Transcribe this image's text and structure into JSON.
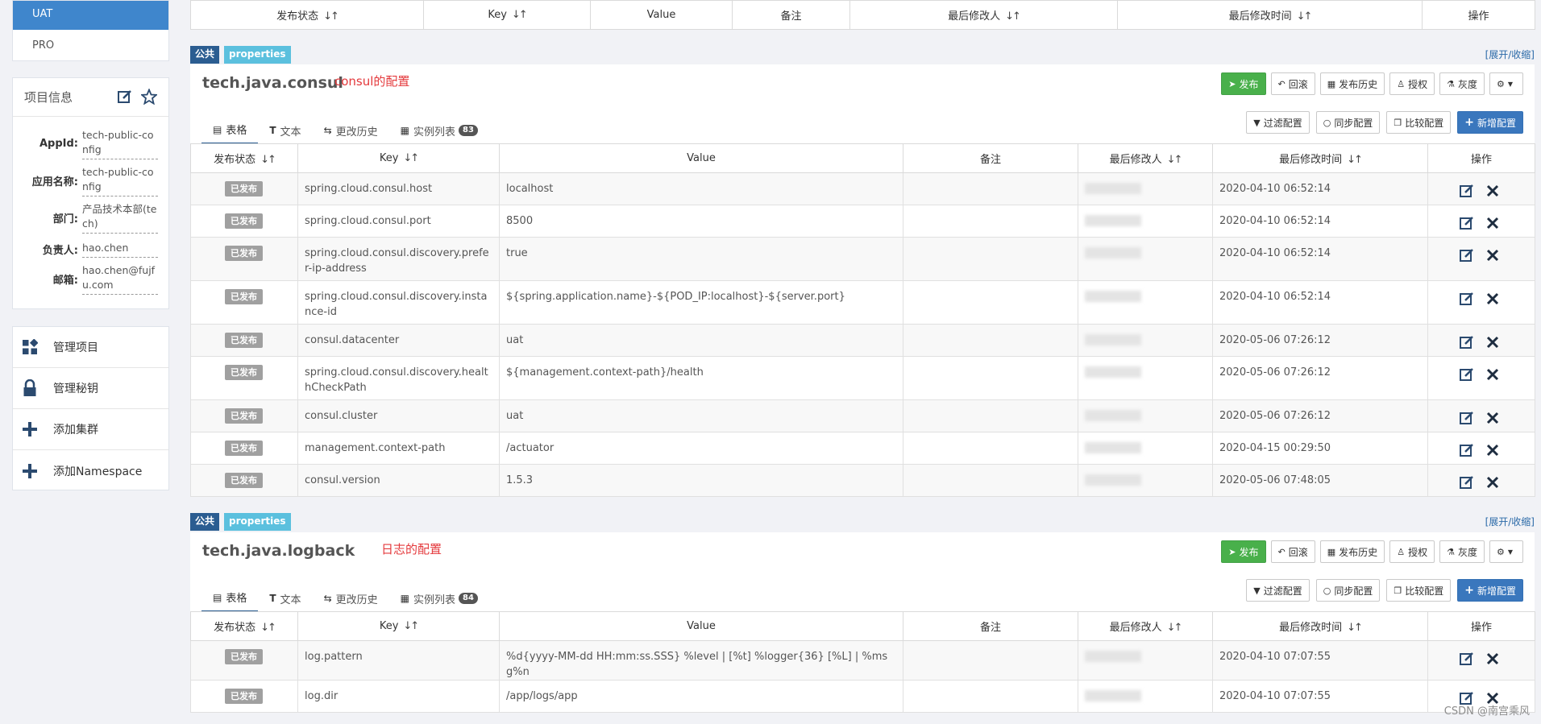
{
  "sidebar": {
    "envs": [
      "UAT",
      "PRO"
    ],
    "info_title": "项目信息",
    "info": [
      {
        "key": "AppId:",
        "value": "tech-public-config"
      },
      {
        "key": "应用名称:",
        "value": "tech-public-config"
      },
      {
        "key": "部门:",
        "value": "产品技术本部(tech)"
      },
      {
        "key": "负责人:",
        "value": "hao.chen"
      },
      {
        "key": "邮箱:",
        "value": "hao.chen@fujfu.com"
      }
    ],
    "menu": [
      {
        "label": "管理项目",
        "icon": "grid-icon"
      },
      {
        "label": "管理秘钥",
        "icon": "lock-icon"
      },
      {
        "label": "添加集群",
        "icon": "plus-icon"
      },
      {
        "label": "添加Namespace",
        "icon": "plus-icon"
      }
    ]
  },
  "columns": {
    "status": "发布状态",
    "key": "Key",
    "value": "Value",
    "comment": "备注",
    "modifier": "最后修改人",
    "time": "最后修改时间",
    "ops": "操作"
  },
  "labels": {
    "public_tag": "公共",
    "format_tag": "properties",
    "expand": "[展开/收缩]",
    "published": "已发布",
    "btn_publish": "发布",
    "btn_rollback": "回滚",
    "btn_history": "发布历史",
    "btn_grant": "授权",
    "btn_gray": "灰度",
    "btn_filter": "过滤配置",
    "btn_sync": "同步配置",
    "btn_compare": "比较配置",
    "btn_add": "新增配置",
    "tab_table": "表格",
    "tab_text": "文本",
    "tab_history": "更改历史",
    "tab_instances": "实例列表"
  },
  "namespaces": [
    {
      "name": "tech.java.consul",
      "comment": "consul的配置",
      "instance_count": "83",
      "rows": [
        {
          "key": "spring.cloud.consul.host",
          "value": "localhost",
          "time": "2020-04-10 06:52:14"
        },
        {
          "key": "spring.cloud.consul.port",
          "value": "8500",
          "time": "2020-04-10 06:52:14"
        },
        {
          "key": "spring.cloud.consul.discovery.prefer-ip-address",
          "value": "true",
          "time": "2020-04-10 06:52:14"
        },
        {
          "key": "spring.cloud.consul.discovery.instance-id",
          "value": "${spring.application.name}-${POD_IP:localhost}-${server.port}",
          "time": "2020-04-10 06:52:14"
        },
        {
          "key": "consul.datacenter",
          "value": "uat",
          "time": "2020-05-06 07:26:12"
        },
        {
          "key": "spring.cloud.consul.discovery.healthCheckPath",
          "value": "${management.context-path}/health",
          "time": "2020-05-06 07:26:12"
        },
        {
          "key": "consul.cluster",
          "value": "uat",
          "time": "2020-05-06 07:26:12"
        },
        {
          "key": "management.context-path",
          "value": "/actuator",
          "time": "2020-04-15 00:29:50"
        },
        {
          "key": "consul.version",
          "value": "1.5.3",
          "time": "2020-05-06 07:48:05"
        }
      ]
    },
    {
      "name": "tech.java.logback",
      "comment": "日志的配置",
      "instance_count": "84",
      "rows": [
        {
          "key": "log.pattern",
          "value": "%d{yyyy-MM-dd HH:mm:ss.SSS} %level | [%t] %logger{36} [%L] | %msg%n",
          "time": "2020-04-10 07:07:55"
        },
        {
          "key": "log.dir",
          "value": "/app/logs/app",
          "time": "2020-04-10 07:07:55"
        }
      ]
    }
  ],
  "watermark": "CSDN @南宫乘风"
}
